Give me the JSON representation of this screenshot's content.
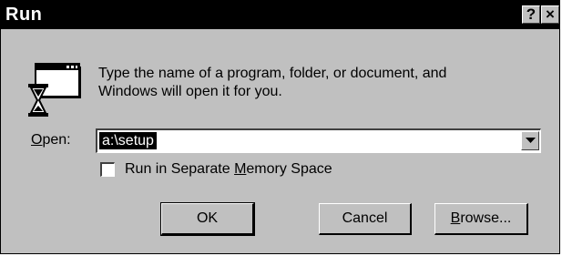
{
  "window": {
    "title": "Run",
    "help_label": "?",
    "close_label": "×"
  },
  "dialog": {
    "icon": "run-program-icon",
    "prompt_line1": "Type the name of a program, folder, or document, and",
    "prompt_line2": "Windows will open it for you."
  },
  "open_field": {
    "label_mnemonic": "O",
    "label_rest": "pen:",
    "value": "a:\\setup"
  },
  "separate_memory": {
    "label_before": "Run in Separate ",
    "label_mnemonic": "M",
    "label_after": "emory Space",
    "checked": false
  },
  "buttons": {
    "ok_label": "OK",
    "cancel_label": "Cancel",
    "browse_mnemonic": "B",
    "browse_rest": "rowse..."
  },
  "colors": {
    "title_bar": "#000000",
    "face": "#c0c0c0",
    "selection": "#000000"
  }
}
